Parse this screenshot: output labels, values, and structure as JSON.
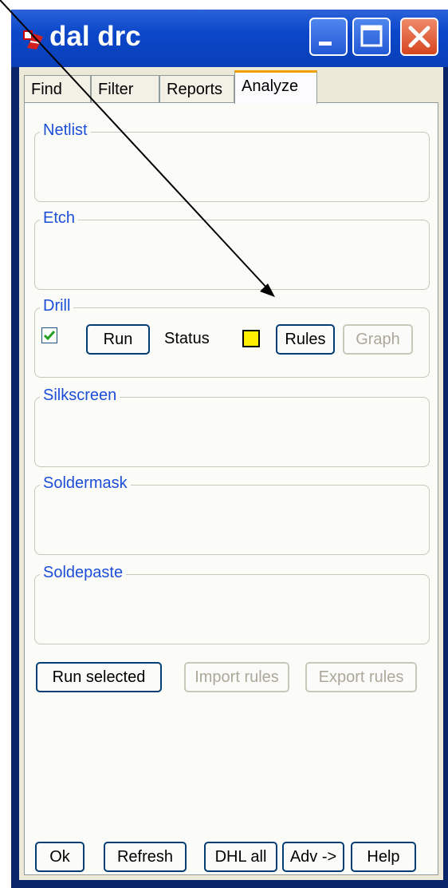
{
  "window": {
    "title": "dal drc"
  },
  "tabs": [
    {
      "label": "Find"
    },
    {
      "label": "Filter"
    },
    {
      "label": "Reports"
    },
    {
      "label": "Analyze"
    }
  ],
  "groups": {
    "netlist": "Netlist",
    "etch": "Etch",
    "drill": "Drill",
    "silkscreen": "Silkscreen",
    "soldermask": "Soldermask",
    "soldepaste": "Soldepaste"
  },
  "drill": {
    "checked": true,
    "run_label": "Run",
    "status_label": "Status",
    "status_color": "#ffee00",
    "rules_label": "Rules",
    "graph_label": "Graph"
  },
  "actions": {
    "run_selected": "Run selected",
    "import_rules": "Import rules",
    "export_rules": "Export rules"
  },
  "footer": {
    "ok": "Ok",
    "refresh": "Refresh",
    "dhl_all": "DHL all",
    "adv": "Adv ->",
    "help": "Help"
  }
}
